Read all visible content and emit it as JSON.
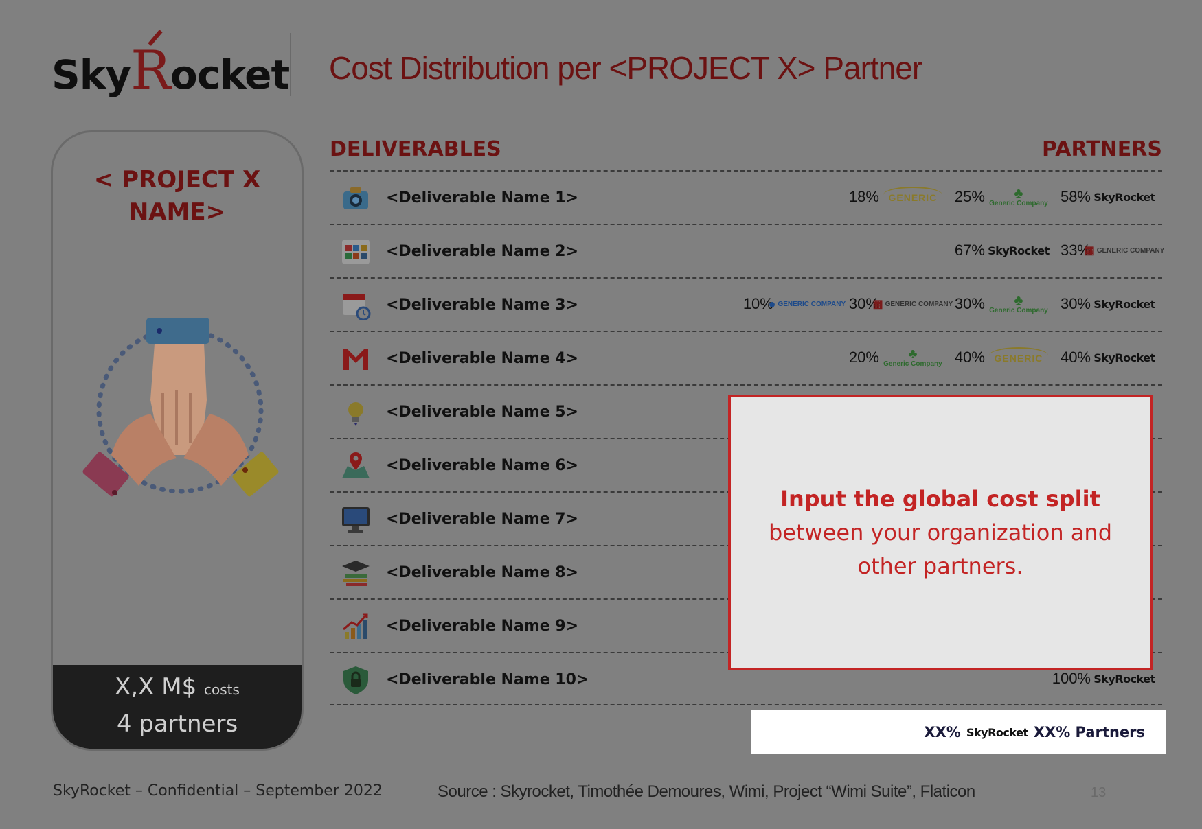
{
  "header": {
    "logo_text_left": "Sky",
    "logo_letter": "R",
    "logo_text_right": "ocket",
    "title": "Cost Distribution per <PROJECT X> Partner"
  },
  "project_card": {
    "name": "< PROJECT X NAME>",
    "cost_value": "X,X M$",
    "cost_unit": "costs",
    "partners_count": "4 partners"
  },
  "columns": {
    "left": "DELIVERABLES",
    "right": "PARTNERS"
  },
  "deliverables": [
    {
      "name": "<Deliverable Name 1>",
      "icon": "camera-icon",
      "shares": [
        {
          "pct": "18%",
          "partner": "generic-car-dealer",
          "logo": "GENERIC"
        },
        {
          "pct": "25%",
          "partner": "generic-tree-company",
          "logo": "Generic Company"
        },
        {
          "pct": "58%",
          "partner": "skyrocket",
          "logo": "SkyRocket"
        }
      ]
    },
    {
      "name": "<Deliverable Name 2>",
      "icon": "app-grid-icon",
      "shares": [
        {
          "pct": "67%",
          "partner": "skyrocket",
          "logo": "SkyRocket"
        },
        {
          "pct": "33%",
          "partner": "generic-tiles-company",
          "logo": "GENERIC COMPANY"
        }
      ]
    },
    {
      "name": "<Deliverable Name 3>",
      "icon": "calendar-clock-icon",
      "shares": [
        {
          "pct": "10%",
          "partner": "generic-drop-company",
          "logo": "GENERIC COMPANY"
        },
        {
          "pct": "30%",
          "partner": "generic-tiles-company",
          "logo": "GENERIC COMPANY"
        },
        {
          "pct": "30%",
          "partner": "generic-tree-company",
          "logo": "Generic Company"
        },
        {
          "pct": "30%",
          "partner": "skyrocket",
          "logo": "SkyRocket"
        }
      ]
    },
    {
      "name": "<Deliverable Name 4>",
      "icon": "mail-icon",
      "shares": [
        {
          "pct": "20%",
          "partner": "generic-tree-company",
          "logo": "Generic Company"
        },
        {
          "pct": "40%",
          "partner": "generic-car-dealer",
          "logo": "GENERIC"
        },
        {
          "pct": "40%",
          "partner": "skyrocket",
          "logo": "SkyRocket"
        }
      ]
    },
    {
      "name": "<Deliverable Name 5>",
      "icon": "lightbulb-icon",
      "shares": []
    },
    {
      "name": "<Deliverable Name 6>",
      "icon": "map-pin-icon",
      "shares": []
    },
    {
      "name": "<Deliverable Name 7>",
      "icon": "monitor-icon",
      "shares": []
    },
    {
      "name": "<Deliverable Name 8>",
      "icon": "graduation-books-icon",
      "shares": []
    },
    {
      "name": "<Deliverable Name 9>",
      "icon": "growth-chart-icon",
      "shares": []
    },
    {
      "name": "<Deliverable Name 10>",
      "icon": "shield-lock-icon",
      "shares": [
        {
          "pct": "100%",
          "partner": "skyrocket",
          "logo": "SkyRocket"
        }
      ]
    }
  ],
  "callout": {
    "bold": "Input the global cost split",
    "rest": " between your organization and other partners."
  },
  "summary": {
    "own_pct": "XX%",
    "own_logo": "SkyRocket",
    "partners_text": "XX% Partners"
  },
  "footer": {
    "confidential": "SkyRocket – Confidential – September 2022",
    "source": "Source : Skyrocket, Timothée Demoures, Wimi, Project “Wimi Suite”, Flaticon",
    "page": "13"
  },
  "colors": {
    "brand_dark_red": "#6b1212",
    "callout_red": "#c32424",
    "overlay_gray": "#808080"
  }
}
